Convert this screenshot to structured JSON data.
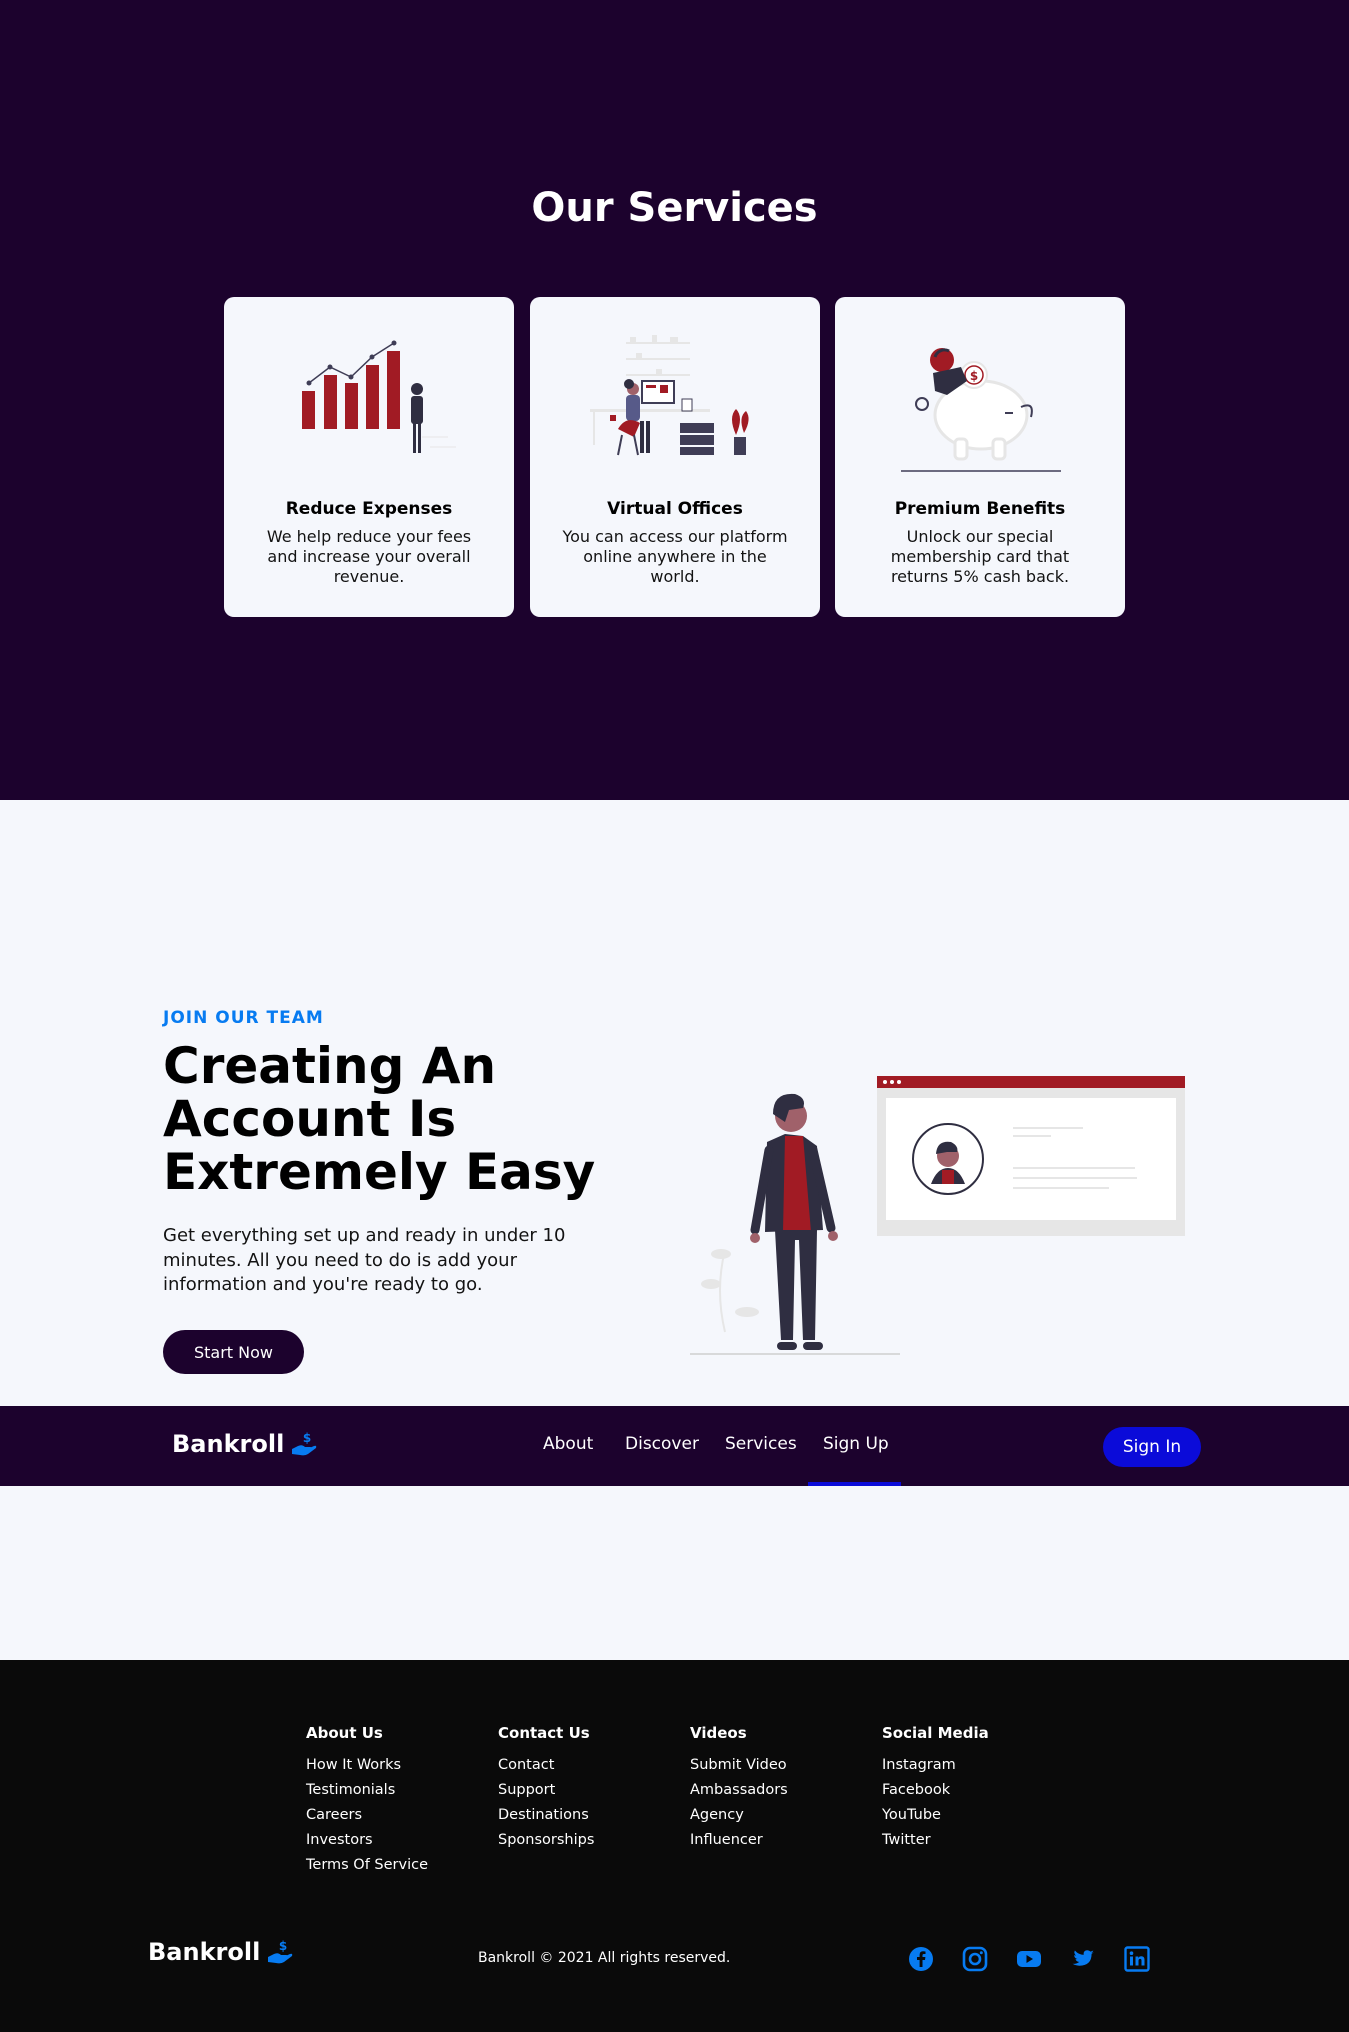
{
  "services": {
    "title": "Our Services",
    "cards": [
      {
        "title": "Reduce Expenses",
        "desc": "We help reduce your fees and increase your overall revenue."
      },
      {
        "title": "Virtual Offices",
        "desc": "You can access our platform online anywhere in the world."
      },
      {
        "title": "Premium Benefits",
        "desc": "Unlock our special membership card that returns 5% cash back."
      }
    ],
    "illustration_icons": [
      "growth-chart-icon",
      "office-desk-icon",
      "piggy-bank-icon"
    ]
  },
  "join": {
    "eyebrow": "JOIN OUR TEAM",
    "heading": "Creating An Account Is Extremely Easy",
    "desc": "Get everything set up and ready in under 10 minutes. All you need to do is add your information and you're ready to go.",
    "cta": "Start Now"
  },
  "navbar": {
    "brand": "Bankroll",
    "links": [
      "About",
      "Discover",
      "Services",
      "Sign Up"
    ],
    "active_link": "Sign Up",
    "signin": "Sign In"
  },
  "footer": {
    "columns": [
      {
        "heading": "About Us",
        "links": [
          "How It Works",
          "Testimonials",
          "Careers",
          "Investors",
          "Terms Of Service"
        ]
      },
      {
        "heading": "Contact Us",
        "links": [
          "Contact",
          "Support",
          "Destinations",
          "Sponsorships"
        ]
      },
      {
        "heading": "Videos",
        "links": [
          "Submit Video",
          "Ambassadors",
          "Agency",
          "Influencer"
        ]
      },
      {
        "heading": "Social Media",
        "links": [
          "Instagram",
          "Facebook",
          "YouTube",
          "Twitter"
        ]
      }
    ],
    "brand": "Bankroll",
    "copyright": "Bankroll © 2021 All rights reserved.",
    "social_icons": [
      "facebook-icon",
      "instagram-icon",
      "youtube-icon",
      "twitter-icon",
      "linkedin-icon"
    ]
  },
  "colors": {
    "dark_purple": "#1c022d",
    "accent_blue": "#077bf1",
    "button_blue": "#0b0bd9",
    "illustration_red": "#a11b24",
    "footer_bg": "#0a0a0a",
    "light_bg": "#f5f7fc"
  }
}
